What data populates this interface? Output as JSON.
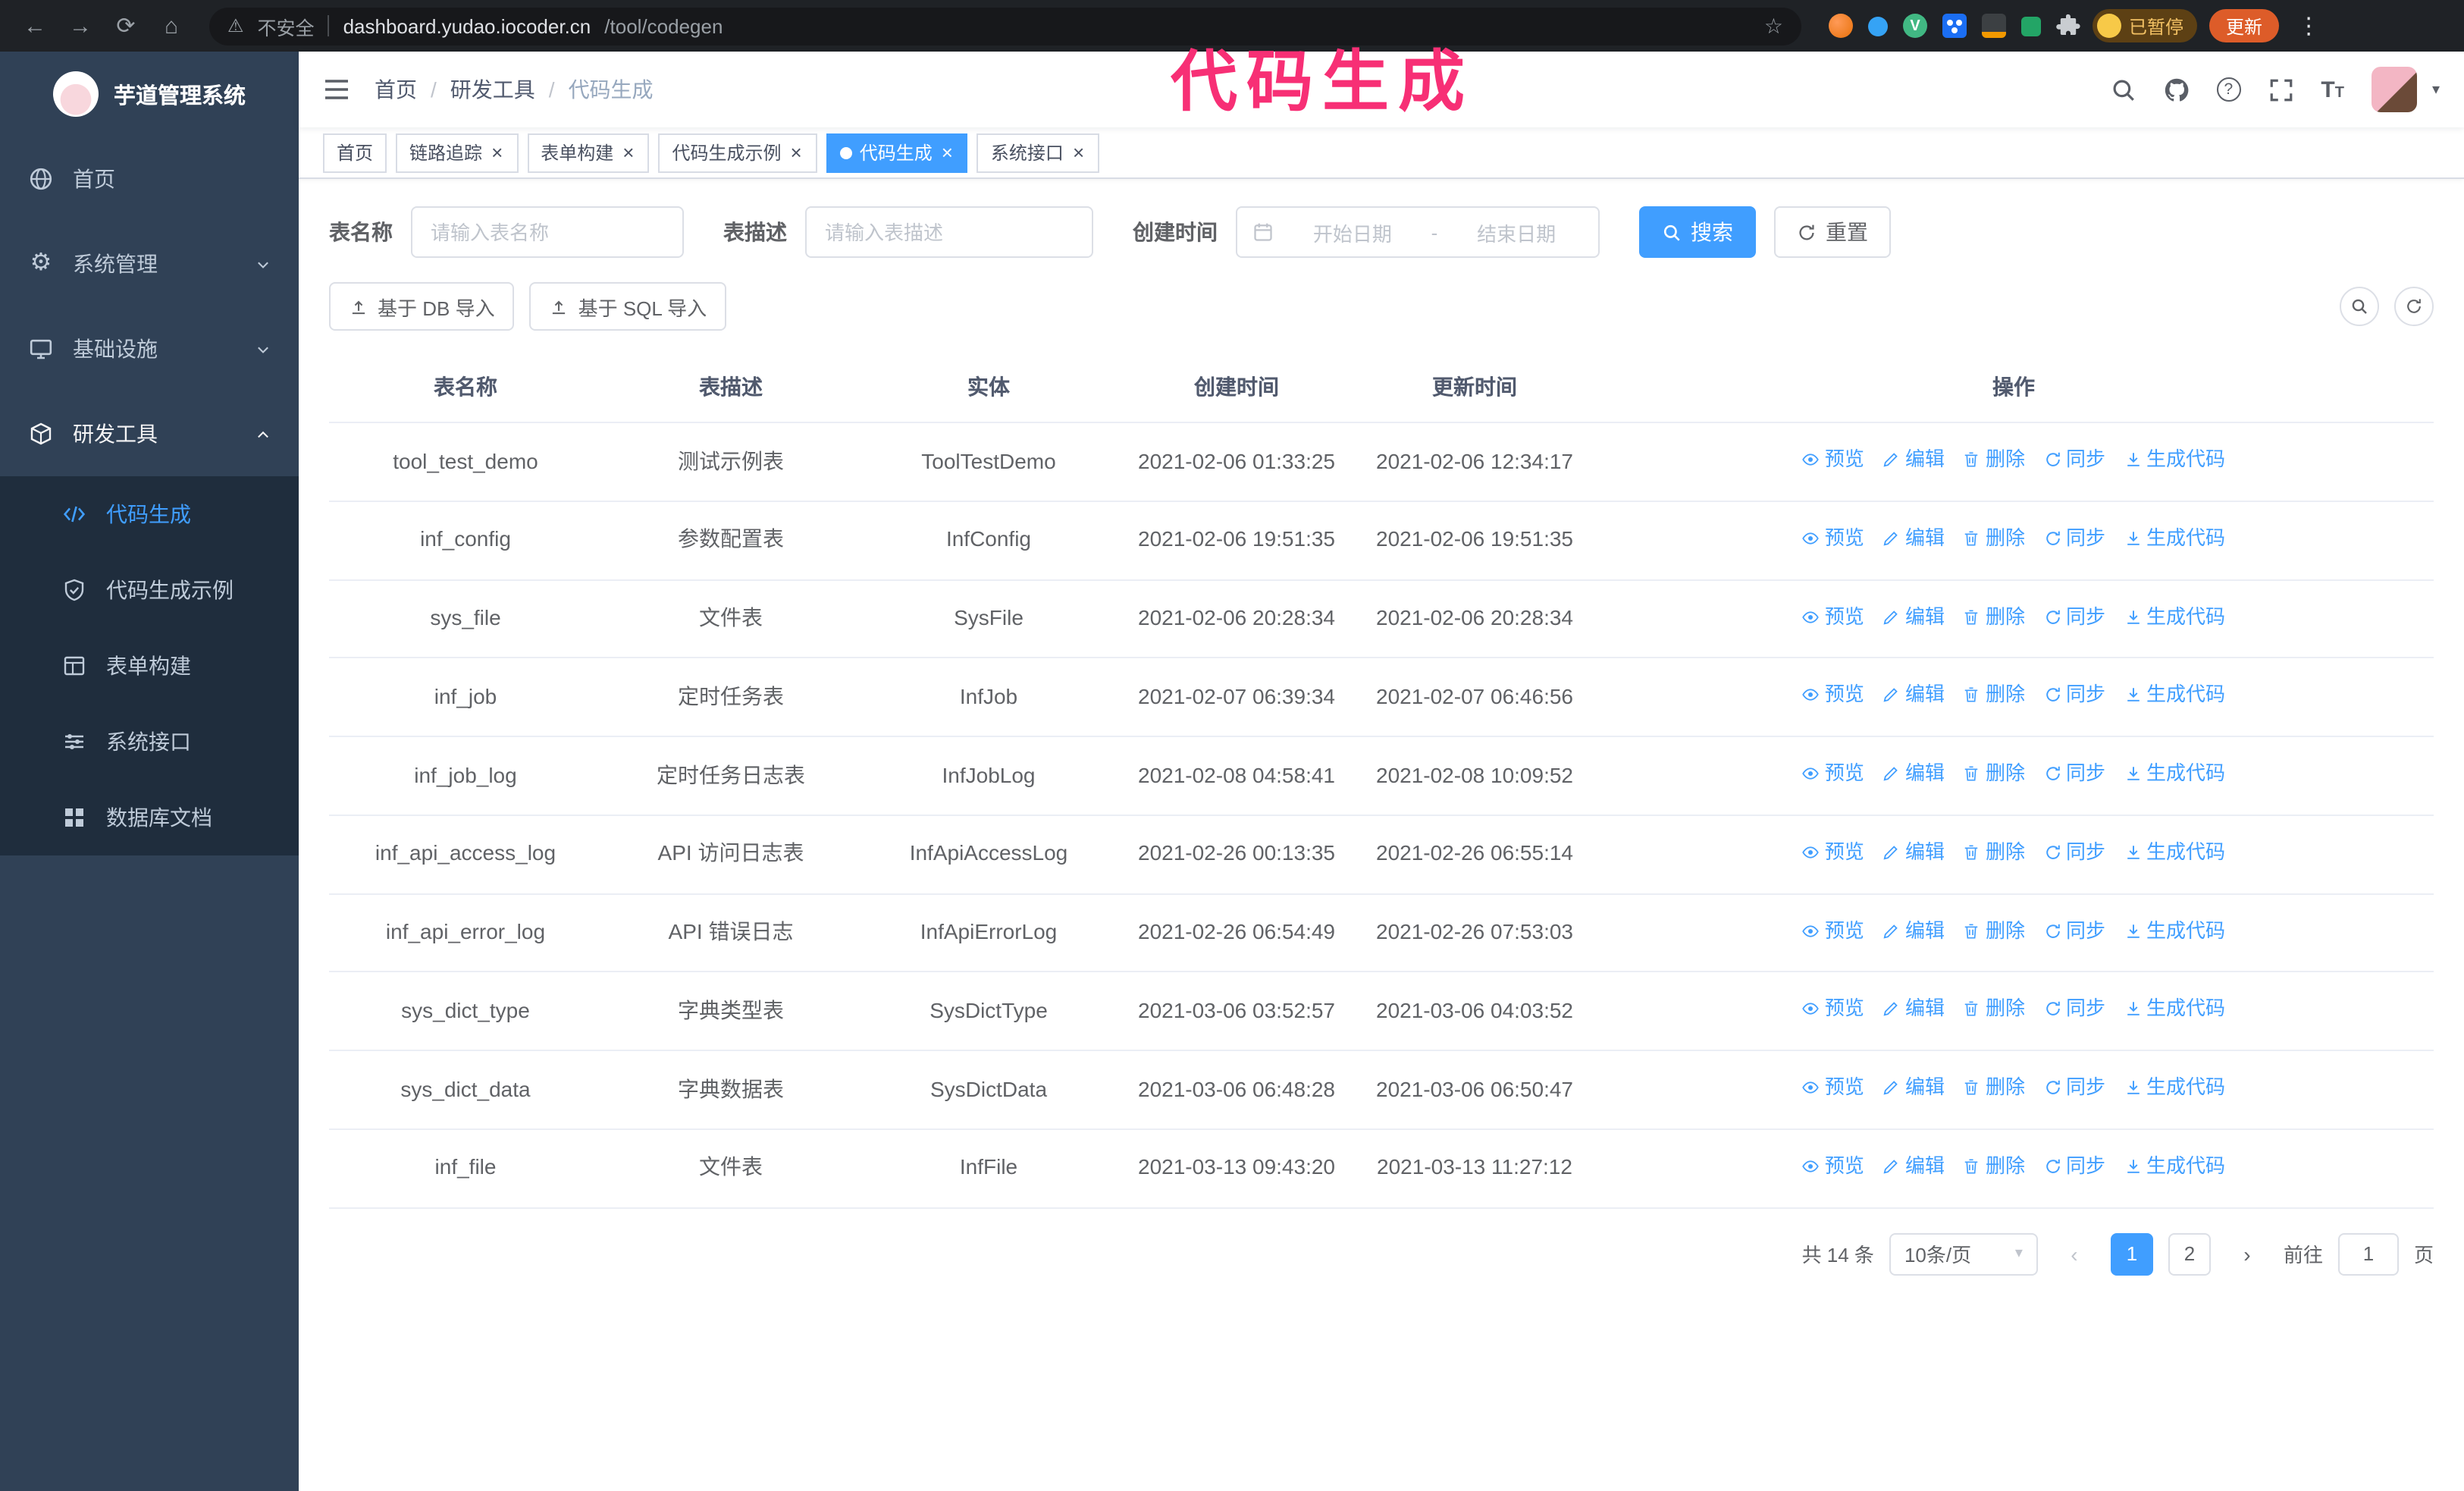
{
  "browser": {
    "security_label": "不安全",
    "url_host": "dashboard.yudao.iocoder.cn",
    "url_path": "/tool/codegen",
    "paused_badge": "已暂停",
    "update_button": "更新"
  },
  "icons": {
    "back": "←",
    "forward": "→",
    "reload": "⟳",
    "home": "⌂",
    "warning": "⚠",
    "star": "☆",
    "menu_dots": "⋮",
    "gear": "⚙",
    "caret_down": "▾",
    "close": "×",
    "question": "?",
    "vue_letter": "V",
    "prev_arrow": "‹",
    "next_arrow": "›",
    "font_big": "T",
    "font_small": "T"
  },
  "annotation": {
    "text": "代码生成",
    "color": "#f72f75"
  },
  "sidebar": {
    "logo_title": "芋道管理系统",
    "items": [
      {
        "label": "首页"
      },
      {
        "label": "系统管理"
      },
      {
        "label": "基础设施"
      },
      {
        "label": "研发工具"
      }
    ],
    "submenu": [
      {
        "label": "代码生成",
        "active": true
      },
      {
        "label": "代码生成示例"
      },
      {
        "label": "表单构建"
      },
      {
        "label": "系统接口"
      },
      {
        "label": "数据库文档"
      }
    ]
  },
  "header": {
    "breadcrumb": [
      "首页",
      "研发工具",
      "代码生成"
    ],
    "breadcrumb_sep": "/"
  },
  "tags": [
    {
      "label": "首页",
      "closable": false,
      "active": false
    },
    {
      "label": "链路追踪",
      "closable": true,
      "active": false
    },
    {
      "label": "表单构建",
      "closable": true,
      "active": false
    },
    {
      "label": "代码生成示例",
      "closable": true,
      "active": false
    },
    {
      "label": "代码生成",
      "closable": true,
      "active": true
    },
    {
      "label": "系统接口",
      "closable": true,
      "active": false
    }
  ],
  "filters": {
    "table_name_label": "表名称",
    "table_name_placeholder": "请输入表名称",
    "table_desc_label": "表描述",
    "table_desc_placeholder": "请输入表描述",
    "create_time_label": "创建时间",
    "date_start_placeholder": "开始日期",
    "date_separator": "-",
    "date_end_placeholder": "结束日期",
    "search_button": "搜索",
    "reset_button": "重置"
  },
  "toolbar": {
    "import_db_button": "基于 DB 导入",
    "import_sql_button": "基于 SQL 导入"
  },
  "table": {
    "columns": [
      "表名称",
      "表描述",
      "实体",
      "创建时间",
      "更新时间",
      "操作"
    ],
    "ops": [
      "预览",
      "编辑",
      "删除",
      "同步",
      "生成代码"
    ],
    "rows": [
      [
        "tool_test_demo",
        "测试示例表",
        "ToolTestDemo",
        "2021-02-06 01:33:25",
        "2021-02-06 12:34:17"
      ],
      [
        "inf_config",
        "参数配置表",
        "InfConfig",
        "2021-02-06 19:51:35",
        "2021-02-06 19:51:35"
      ],
      [
        "sys_file",
        "文件表",
        "SysFile",
        "2021-02-06 20:28:34",
        "2021-02-06 20:28:34"
      ],
      [
        "inf_job",
        "定时任务表",
        "InfJob",
        "2021-02-07 06:39:34",
        "2021-02-07 06:46:56"
      ],
      [
        "inf_job_log",
        "定时任务日志表",
        "InfJobLog",
        "2021-02-08 04:58:41",
        "2021-02-08 10:09:52"
      ],
      [
        "inf_api_access_log",
        "API 访问日志表",
        "InfApiAccessLog",
        "2021-02-26 00:13:35",
        "2021-02-26 06:55:14"
      ],
      [
        "inf_api_error_log",
        "API 错误日志",
        "InfApiErrorLog",
        "2021-02-26 06:54:49",
        "2021-02-26 07:53:03"
      ],
      [
        "sys_dict_type",
        "字典类型表",
        "SysDictType",
        "2021-03-06 03:52:57",
        "2021-03-06 04:03:52"
      ],
      [
        "sys_dict_data",
        "字典数据表",
        "SysDictData",
        "2021-03-06 06:48:28",
        "2021-03-06 06:50:47"
      ],
      [
        "inf_file",
        "文件表",
        "InfFile",
        "2021-03-13 09:43:20",
        "2021-03-13 11:27:12"
      ]
    ]
  },
  "pagination": {
    "total": "共 14 条",
    "page_size": "10条/页",
    "pages": [
      "1",
      "2"
    ],
    "goto_label": "前往",
    "goto_value": "1",
    "goto_suffix": "页"
  },
  "colors": {
    "primary": "#409eff",
    "sidebar_bg": "#304156",
    "submenu_bg": "#1f2d3d",
    "annotation_pink": "#f72f75",
    "update_orange": "#dd5c29"
  }
}
